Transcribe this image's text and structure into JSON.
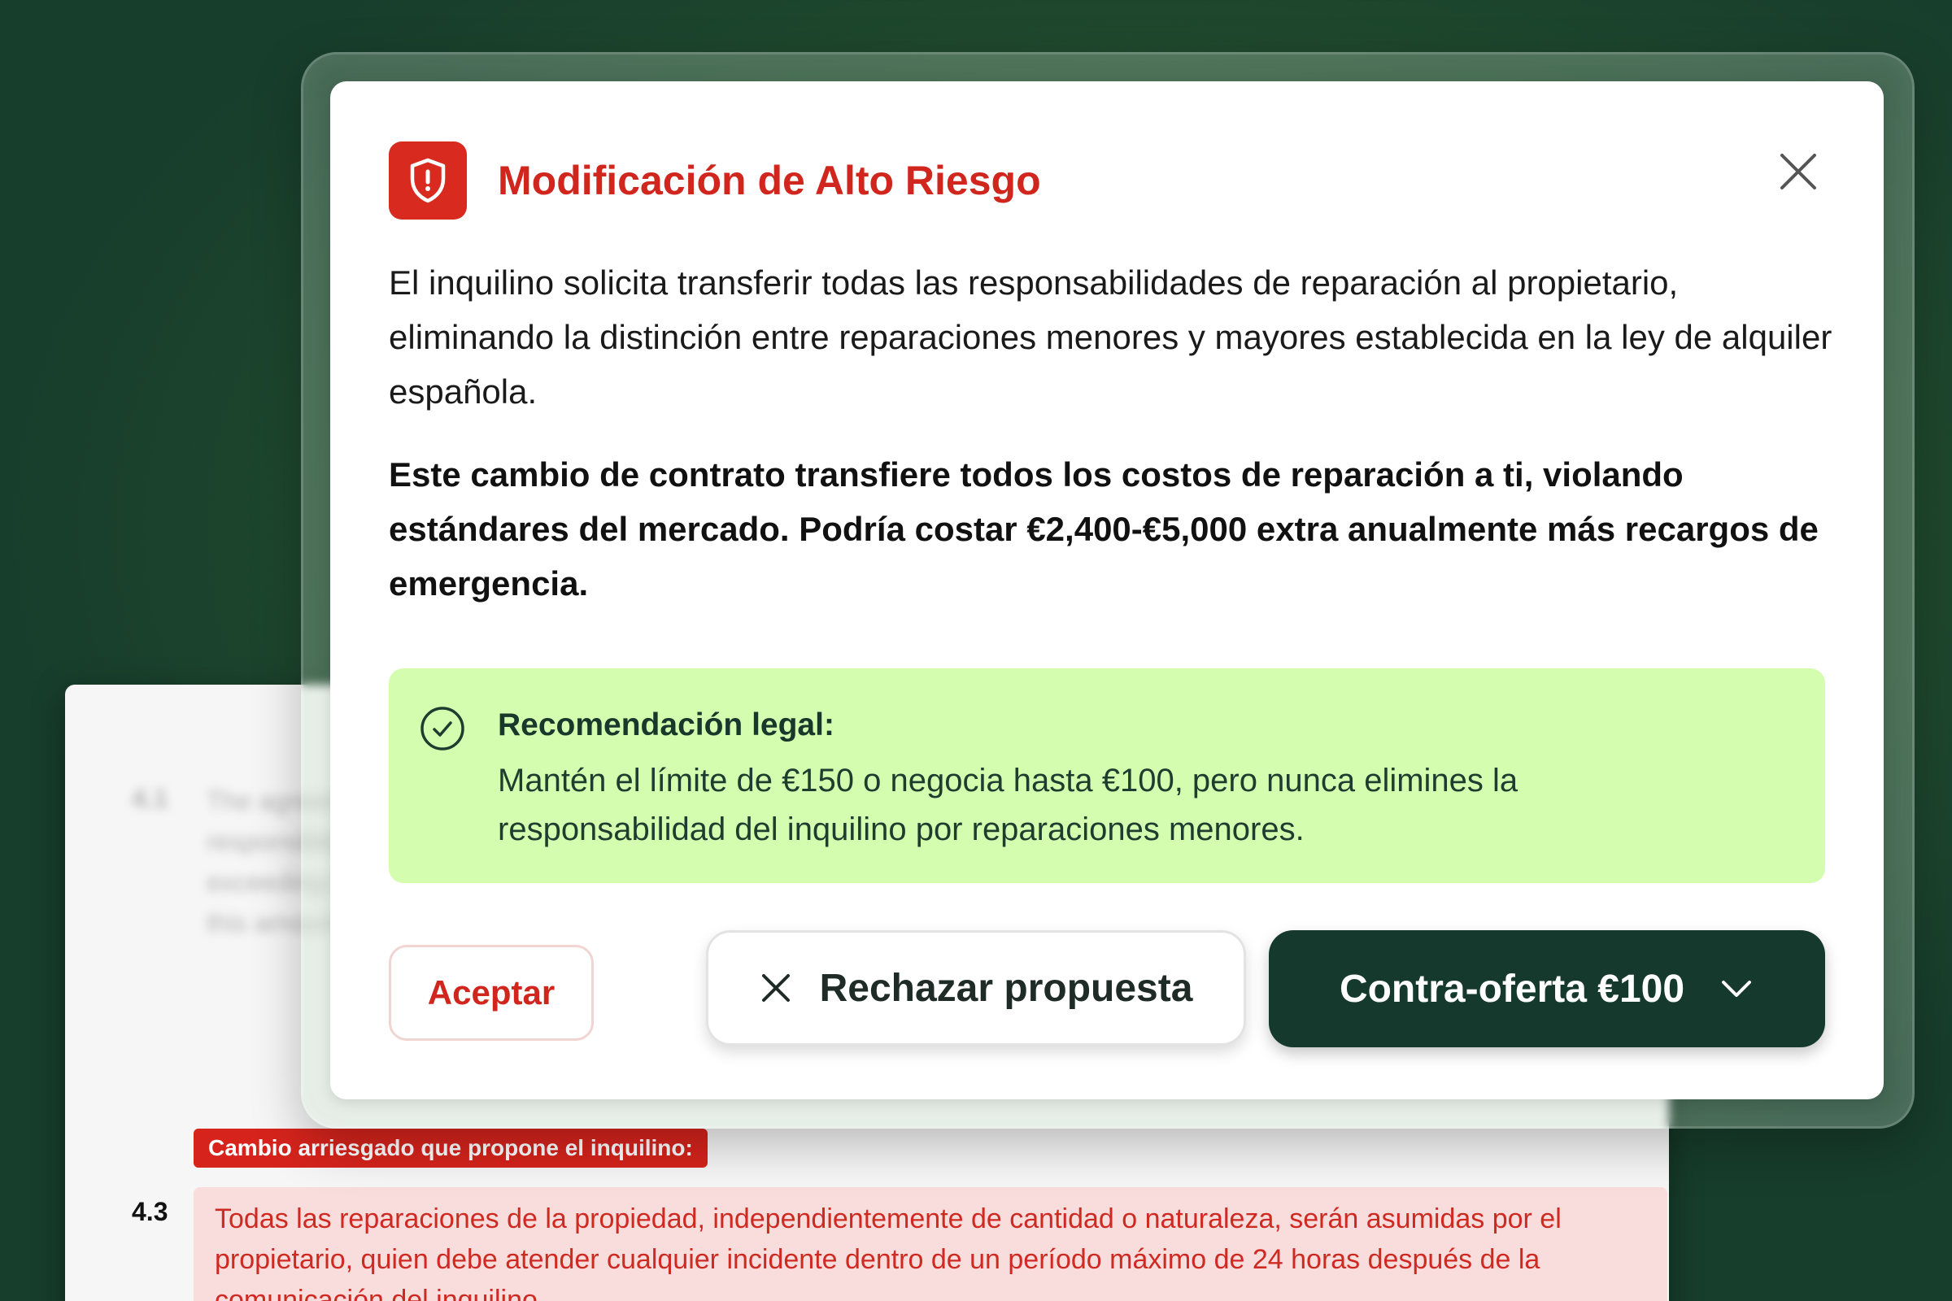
{
  "document": {
    "clause_blurred": {
      "number": "4.1",
      "text": "The agreement is made by both parties. The tenant is responsible for minor repairs and extraordinary repairs exceeding the agreed amount; minor repairs will be paid up to this amount"
    },
    "risk_tag": "Cambio arriesgado que propone el inquilino:",
    "risk_clause": {
      "number": "4.3",
      "text": "Todas las reparaciones de la propiedad, independientemente de cantidad o naturaleza, serán asumidas por el propietario, quien debe atender cualquier incidente dentro de un período máximo de 24 horas después de la comunicación del inquilino."
    }
  },
  "modal": {
    "icon": "shield-alert-icon",
    "title": "Modificación de Alto Riesgo",
    "description": "El inquilino solicita transferir todas las responsabilidades de reparación al propietario, eliminando la distinción entre reparaciones menores y mayores establecida en la ley de alquiler española.",
    "warning": "Este cambio de contrato transfiere todos los costos de reparación a ti, violando estándares del mercado. Podría costar €2,400-€5,000 extra anualmente más recargos de emergencia.",
    "recommendation": {
      "icon": "check-circle-icon",
      "title": "Recomendación legal:",
      "text": "Mantén el límite de €150 o negocia hasta €100, pero nunca elimines la responsabilidad del inquilino por reparaciones menores."
    },
    "actions": {
      "accept": "Aceptar",
      "reject": "Rechazar propuesta",
      "counter": "Contra-oferta €100"
    }
  },
  "colors": {
    "danger": "#d92a1f",
    "success_bg": "#d4fdb0",
    "primary_dark": "#153a2d"
  }
}
